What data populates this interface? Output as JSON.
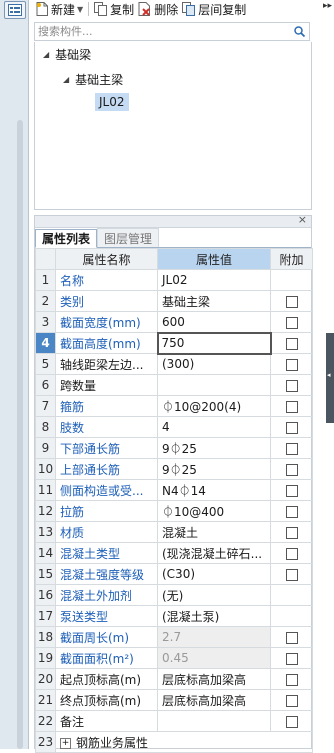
{
  "toolbar": {
    "new_label": "新建",
    "copy_label": "复制",
    "delete_label": "删除",
    "floor_copy_label": "层间复制",
    "more": "▸▸"
  },
  "search": {
    "placeholder": "搜索构件..."
  },
  "tree": {
    "root": "基础梁",
    "child": "基础主梁",
    "leaf": "JL02"
  },
  "tabs": [
    {
      "label": "属性列表"
    },
    {
      "label": "图层管理"
    }
  ],
  "table": {
    "headers": {
      "name": "属性名称",
      "value": "属性值",
      "extra": "附加"
    },
    "rows": [
      {
        "num": "1",
        "name": "名称",
        "value": "JL02",
        "blue": true,
        "check": false
      },
      {
        "num": "2",
        "name": "类别",
        "value": "基础主梁",
        "blue": true,
        "check": true
      },
      {
        "num": "3",
        "name": "截面宽度(mm)",
        "value": "600",
        "blue": true,
        "check": true
      },
      {
        "num": "4",
        "name": "截面高度(mm)",
        "value": "750",
        "blue": true,
        "check": true,
        "selected": true
      },
      {
        "num": "5",
        "name": "轴线距梁左边...",
        "value": "(300)",
        "blue": false,
        "check": true
      },
      {
        "num": "6",
        "name": "跨数量",
        "value": "",
        "blue": false,
        "check": true
      },
      {
        "num": "7",
        "name": "箍筋",
        "value": "⏀10@200(4)",
        "blue": true,
        "check": true
      },
      {
        "num": "8",
        "name": "肢数",
        "value": "4",
        "blue": true,
        "check": true
      },
      {
        "num": "9",
        "name": "下部通长筋",
        "value": "9⏀25",
        "blue": true,
        "check": true
      },
      {
        "num": "10",
        "name": "上部通长筋",
        "value": "9⏀25",
        "blue": true,
        "check": true
      },
      {
        "num": "11",
        "name": "侧面构造或受...",
        "value": "N4⏀14",
        "blue": true,
        "check": true
      },
      {
        "num": "12",
        "name": "拉筋",
        "value": "⏀10@400",
        "blue": true,
        "check": true
      },
      {
        "num": "13",
        "name": "材质",
        "value": "混凝土",
        "blue": true,
        "check": true
      },
      {
        "num": "14",
        "name": "混凝土类型",
        "value": "(现浇混凝土碎石...",
        "blue": true,
        "check": true
      },
      {
        "num": "15",
        "name": "混凝土强度等级",
        "value": "(C30)",
        "blue": true,
        "check": true
      },
      {
        "num": "16",
        "name": "混凝土外加剂",
        "value": "(无)",
        "blue": true,
        "check": false
      },
      {
        "num": "17",
        "name": "泵送类型",
        "value": "(混凝土泵)",
        "blue": true,
        "check": false
      },
      {
        "num": "18",
        "name": "截面周长(m)",
        "value": "2.7",
        "blue": true,
        "check": true,
        "grey": true
      },
      {
        "num": "19",
        "name": "截面面积(m²)",
        "value": "0.45",
        "blue": true,
        "check": true,
        "grey": true
      },
      {
        "num": "20",
        "name": "起点顶标高(m)",
        "value": "层底标高加梁高",
        "blue": false,
        "check": true
      },
      {
        "num": "21",
        "name": "终点顶标高(m)",
        "value": "层底标高加梁高",
        "blue": false,
        "check": true
      },
      {
        "num": "22",
        "name": "备注",
        "value": "",
        "blue": false,
        "check": true
      },
      {
        "num": "23",
        "name": "钢筋业务属性",
        "value": "",
        "blue": false,
        "check": false,
        "group": true
      }
    ]
  },
  "colors": {
    "selected_row": "#4a86c5",
    "link_text": "#1d5fb8",
    "header_value": "#b9d4ef"
  }
}
